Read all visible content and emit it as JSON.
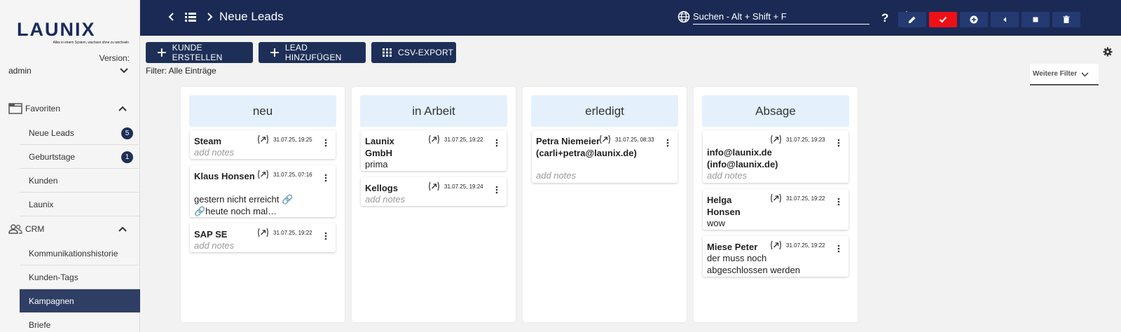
{
  "app": {
    "logo_text": "LAUNIX",
    "logo_tagline": "Alles in einem System, wachsen ohne zu wechseln",
    "version_label": "Version:",
    "user": "admin"
  },
  "sidebar": {
    "sections": [
      {
        "label": "Favoriten",
        "icon": "window-icon"
      },
      {
        "label": "CRM",
        "icon": "users-icon"
      }
    ],
    "items": [
      {
        "label": "Neue Leads",
        "badge": "5"
      },
      {
        "label": "Geburtstage",
        "badge": "1"
      },
      {
        "label": "Kunden",
        "badge": ""
      },
      {
        "label": "Launix",
        "badge": ""
      },
      {
        "label": "Kommunikationshistorie",
        "badge": ""
      },
      {
        "label": "Kunden-Tags",
        "badge": ""
      },
      {
        "label": "Kampagnen",
        "badge": "",
        "active": true
      },
      {
        "label": "Briefe",
        "badge": ""
      }
    ]
  },
  "topbar": {
    "title": "Neue Leads",
    "search_placeholder": "Suchen - Alt + Shift + F",
    "help": "?",
    "colors": {
      "bar": "#1b2a55",
      "button": "#243a73",
      "confirm": "#ef0f16",
      "star": "#f2d21c"
    }
  },
  "actions": {
    "create_customer": "KUNDE ERSTELLEN",
    "add_lead": "LEAD HINZUFÜGEN",
    "csv_export": "CSV-EXPORT"
  },
  "filter": {
    "text": "Filter: Alle Einträge",
    "more_filters": "Weitere Filter"
  },
  "board": {
    "columns": [
      {
        "title": "neu",
        "cards": [
          {
            "title": "Steam",
            "date": "31.07.25, 19:25",
            "text": "add notes",
            "placeholder": true
          },
          {
            "title": "Klaus Honsen",
            "date": "31.07.25, 07:16",
            "text": "gestern nicht erreicht 🔗 🔗heute noch mal…",
            "placeholder": false
          },
          {
            "title": "SAP SE",
            "date": "31.07.25, 19:22",
            "text": "add notes",
            "placeholder": true
          }
        ]
      },
      {
        "title": "in Arbeit",
        "cards": [
          {
            "title": "Launix GmbH",
            "date": "31.07.25, 19:22",
            "text": "prima",
            "placeholder": false
          },
          {
            "title": "Kellogs",
            "date": "31.07.25, 19:24",
            "text": "add notes",
            "placeholder": true
          }
        ]
      },
      {
        "title": "erledigt",
        "cards": [
          {
            "title": "Petra Niemeier (carli+petra@launix.de)",
            "date": "31.07.25, 08:33",
            "text": "add notes",
            "placeholder": true
          }
        ]
      },
      {
        "title": "Absage",
        "cards": [
          {
            "title": "info@launix.de (info@launix.de)",
            "date": "31.07.25, 19:23",
            "text": "add notes",
            "placeholder": true
          },
          {
            "title": "Helga Honsen",
            "date": "31.07.25, 19:22",
            "text": "wow",
            "placeholder": false
          },
          {
            "title": "Miese Peter",
            "date": "31.07.25, 19:22",
            "text": "der muss noch abgeschlossen werden",
            "placeholder": false
          }
        ]
      }
    ]
  }
}
